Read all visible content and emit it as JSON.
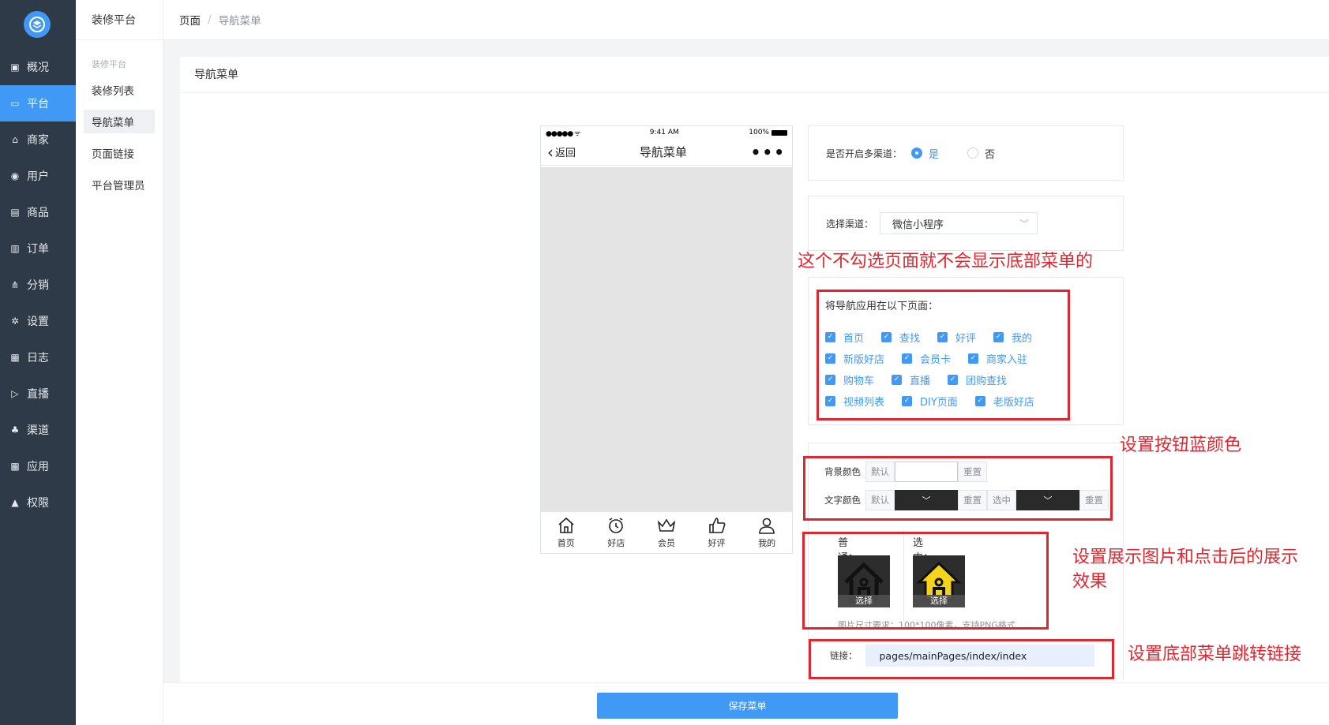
{
  "sidebar": {
    "items": [
      {
        "label": "概况",
        "icon": "overview-icon"
      },
      {
        "label": "平台",
        "icon": "monitor-icon"
      },
      {
        "label": "商家",
        "icon": "store-icon"
      },
      {
        "label": "用户",
        "icon": "user-icon"
      },
      {
        "label": "商品",
        "icon": "goods-icon"
      },
      {
        "label": "订单",
        "icon": "order-icon"
      },
      {
        "label": "分销",
        "icon": "distribution-icon"
      },
      {
        "label": "设置",
        "icon": "gear-icon"
      },
      {
        "label": "日志",
        "icon": "log-icon"
      },
      {
        "label": "直播",
        "icon": "live-icon"
      },
      {
        "label": "渠道",
        "icon": "channel-icon"
      },
      {
        "label": "应用",
        "icon": "apps-icon"
      },
      {
        "label": "权限",
        "icon": "lock-icon"
      }
    ],
    "active_index": 1
  },
  "subnav": {
    "header": "装修平台",
    "group": "装修平台",
    "items": [
      "装修列表",
      "导航菜单",
      "页面链接",
      "平台管理员"
    ],
    "active_index": 1
  },
  "breadcrumb": {
    "root": "页面",
    "separator": "/",
    "current": "导航菜单"
  },
  "card": {
    "title": "导航菜单"
  },
  "phone": {
    "status_time": "9:41 AM",
    "status_battery": "100%",
    "back_label": "返回",
    "title": "导航菜单",
    "more": "•••",
    "tabs": [
      "首页",
      "好店",
      "会员",
      "好评",
      "我的"
    ]
  },
  "multi_channel": {
    "label": "是否开启多渠道：",
    "yes": "是",
    "no": "否",
    "selected": "是"
  },
  "channel": {
    "label": "选择渠道：",
    "value": "微信小程序"
  },
  "pages": {
    "label": "将导航应用在以下页面：",
    "rows": [
      [
        "首页",
        "查找",
        "好评",
        "我的"
      ],
      [
        "新版好店",
        "会员卡",
        "商家入驻"
      ],
      [
        "购物车",
        "直播",
        "团购查找"
      ],
      [
        "视频列表",
        "DIY页面",
        "老版好店"
      ]
    ]
  },
  "colors": {
    "bg_label": "背景颜色",
    "text_label": "文字颜色",
    "default": "默认",
    "reset": "重置",
    "selected": "选中",
    "accent": "#3f99f5"
  },
  "images": {
    "normal_label": "普通：",
    "selected_label": "选中：",
    "choose": "选择",
    "hint": "图片尺寸要求：100*100像素，支持PNG格式"
  },
  "link": {
    "label": "链接：",
    "value": "pages/mainPages/index/index"
  },
  "annotations": {
    "a1": "这个不勾选页面就不会显示底部菜单的",
    "a2": "设置按钮蓝颜色",
    "a3_line1": "设置展示图片和点击后的展示",
    "a3_line2": "效果",
    "a4": "设置底部菜单跳转链接"
  },
  "footer": {
    "save": "保存菜单"
  }
}
